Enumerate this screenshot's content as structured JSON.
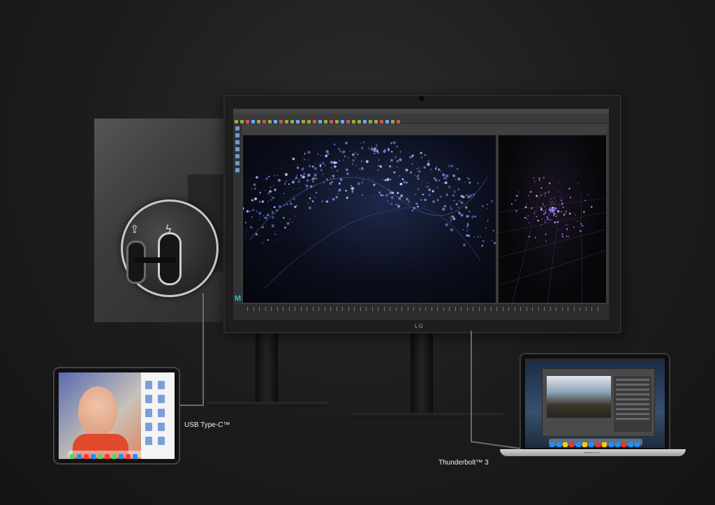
{
  "labels": {
    "usb_c": "USB Type-C™",
    "thunderbolt": "Thunderbolt™ 3"
  },
  "monitor": {
    "brand": "LG"
  },
  "ports": {
    "usb_glyph": "⇪",
    "thunderbolt_glyph": "ϟ"
  },
  "laptop": {
    "name": "MacBook Pro"
  },
  "colors": {
    "background": "#1c1c1c",
    "accent": "#2bc0d9"
  }
}
